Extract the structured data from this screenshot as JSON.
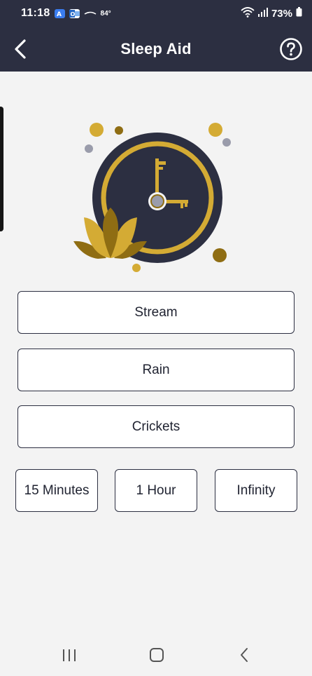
{
  "status_bar": {
    "time": "11:18",
    "temperature": "84°",
    "battery_percent": "73%",
    "icons": [
      "app-a-icon",
      "outlook-icon",
      "weather-cloud-icon",
      "wifi-icon",
      "signal-icon",
      "battery-icon"
    ]
  },
  "header": {
    "title": "Sleep Aid",
    "back_icon": "chevron-left-icon",
    "help_icon": "help-circle-icon"
  },
  "illustration": {
    "icon": "clock-lotus-icon",
    "colors": {
      "clock_face": "#2c2f41",
      "gold": "#d4ab34",
      "dark_gold": "#8f6d13",
      "dot_gray": "#9a9cab"
    }
  },
  "sounds": [
    {
      "label": "Stream"
    },
    {
      "label": "Rain"
    },
    {
      "label": "Crickets"
    }
  ],
  "timers": [
    {
      "label": "15 Minutes"
    },
    {
      "label": "1 Hour"
    },
    {
      "label": "Infinity"
    }
  ],
  "nav_bar": {
    "items": [
      "recent-apps-icon",
      "home-icon",
      "back-icon"
    ]
  },
  "colors": {
    "header_bg": "#2c2f41",
    "page_bg": "#f3f3f3",
    "button_border": "#2c2f41"
  }
}
